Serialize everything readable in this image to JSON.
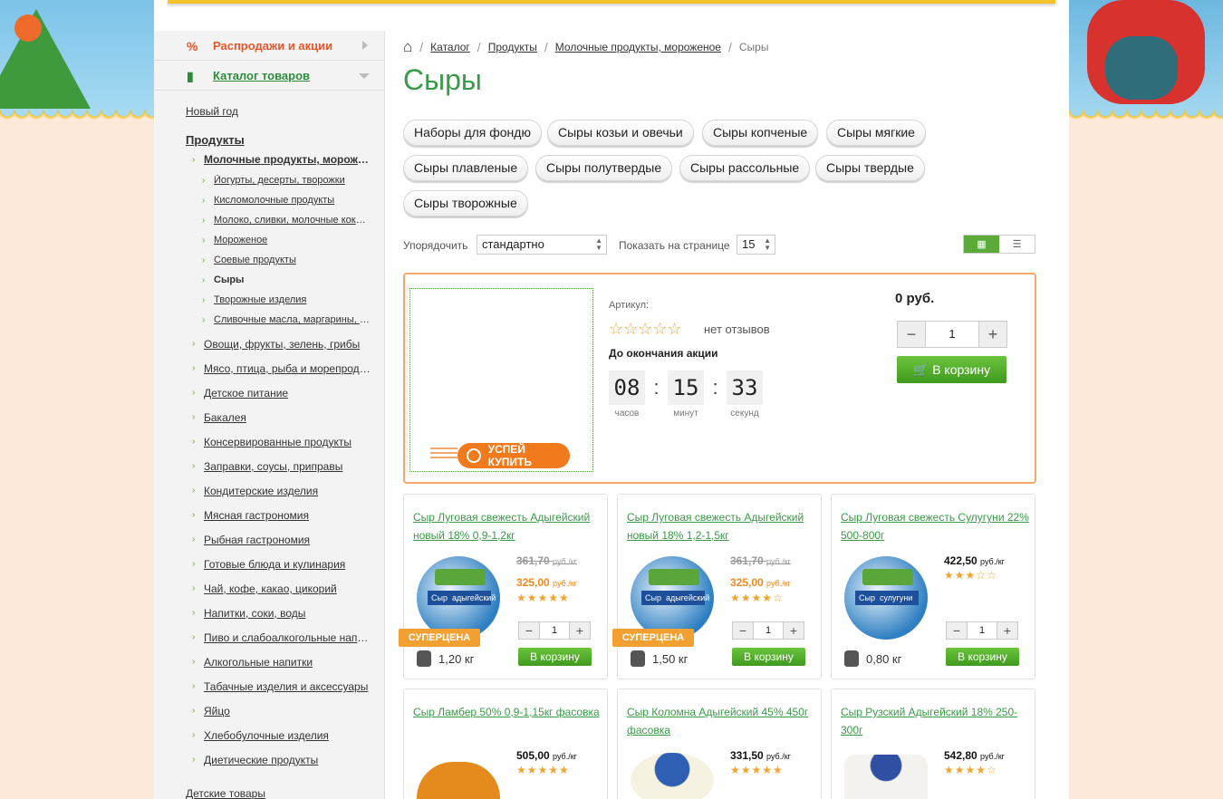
{
  "sidebar": {
    "sale_label": "Распродажи и акции",
    "catalog_label": "Каталог товаров",
    "items": [
      {
        "label": "Новый год"
      },
      {
        "label": "Продукты"
      },
      {
        "label": "Молочные продукты, мороженое"
      },
      {
        "label": "Йогурты, десерты, творожки"
      },
      {
        "label": "Кисломолочные продукты"
      },
      {
        "label": "Молоко, сливки, молочные коктейли"
      },
      {
        "label": "Мороженое"
      },
      {
        "label": "Соевые продукты"
      },
      {
        "label": "Сыры"
      },
      {
        "label": "Творожные изделия"
      },
      {
        "label": "Сливочные масла, маргарины, спреды"
      },
      {
        "label": "Овощи, фрукты, зелень, грибы"
      },
      {
        "label": "Мясо, птица, рыба и морепродукты"
      },
      {
        "label": "Детское питание"
      },
      {
        "label": "Бакалея"
      },
      {
        "label": "Консервированные продукты"
      },
      {
        "label": "Заправки, соусы, приправы"
      },
      {
        "label": "Кондитерские изделия"
      },
      {
        "label": "Мясная гастрономия"
      },
      {
        "label": "Рыбная гастрономия"
      },
      {
        "label": "Готовые блюда и кулинария"
      },
      {
        "label": "Чай, кофе, какао, цикорий"
      },
      {
        "label": "Напитки, соки, воды"
      },
      {
        "label": "Пиво и слабоалкогольные напитки"
      },
      {
        "label": "Алкогольные напитки"
      },
      {
        "label": "Табачные изделия и аксессуары"
      },
      {
        "label": "Яйцо"
      },
      {
        "label": "Хлебобулочные изделия"
      },
      {
        "label": "Диетические продукты"
      },
      {
        "label": "Детские товары"
      }
    ]
  },
  "breadcrumb": {
    "c1": "Каталог",
    "c2": "Продукты",
    "c3": "Молочные продукты, мороженое",
    "current": "Сыры"
  },
  "page_title": "Сыры",
  "tags": [
    "Наборы для фондю",
    "Сыры козьи и овечьи",
    "Сыры копченые",
    "Сыры мягкие",
    "Сыры плавленые",
    "Сыры полутвердые",
    "Сыры рассольные",
    "Сыры твердые",
    "Сыры творожные"
  ],
  "sort": {
    "label": "Упорядочить",
    "value": "стандартно",
    "per_page_label": "Показать на странице",
    "per_page": "15"
  },
  "promo": {
    "article_label": "Артикул:",
    "stars": "☆☆☆☆☆",
    "reviews": "нет отзывов",
    "until": "До окончания акции",
    "hours": "08",
    "minutes": "15",
    "seconds": "33",
    "hours_label": "часов",
    "minutes_label": "минут",
    "seconds_label": "секунд",
    "price": "0 руб.",
    "qty": "1",
    "cart": "В корзину",
    "hurry": "УСПЕЙ КУПИТЬ"
  },
  "products": [
    {
      "name": "Сыр Луговая свежесть Адыгейский новый 18% 0,9-1,2кг",
      "old_price": "361,70",
      "price": "325,00",
      "unit": "руб./кг",
      "stars": "★★★★★",
      "weight": "1,20 кг",
      "badge": "СУПЕРЦЕНА",
      "qty": "1",
      "cart": "В корзину",
      "label": "Сыр",
      "brand": "адыгейский"
    },
    {
      "name": "Сыр Луговая свежесть Адыгейский новый 18% 1,2-1,5кг",
      "old_price": "361,70",
      "price": "325,00",
      "unit": "руб./кг",
      "stars": "★★★★☆",
      "weight": "1,50 кг",
      "badge": "СУПЕРЦЕНА",
      "qty": "1",
      "cart": "В корзину",
      "label": "Сыр",
      "brand": "адыгейский"
    },
    {
      "name": "Сыр Луговая свежесть Сулугуни 22% 500-800г",
      "price": "422,50",
      "unit": "руб./кг",
      "stars": "★★★☆☆",
      "weight": "0,80 кг",
      "qty": "1",
      "cart": "В корзину",
      "label": "Сыр",
      "brand": "сулугуни"
    },
    {
      "name": "Сыр Ламбер 50% 0,9-1,15кг фасовка",
      "price": "505,00",
      "unit": "руб./кг",
      "stars": "★★★★★"
    },
    {
      "name": "Сыр Коломна Адыгейский 45% 450г фасовка",
      "price": "331,50",
      "unit": "руб./кг",
      "stars": "★★★★★"
    },
    {
      "name": "Сыр Рузский Адыгейский 18% 250-300г",
      "price": "542,80",
      "unit": "руб./кг",
      "stars": "★★★★☆"
    }
  ],
  "colors": {
    "accent_green": "#3a9a48",
    "sale_orange": "#e8572a",
    "promo_border": "#f3a96c"
  }
}
